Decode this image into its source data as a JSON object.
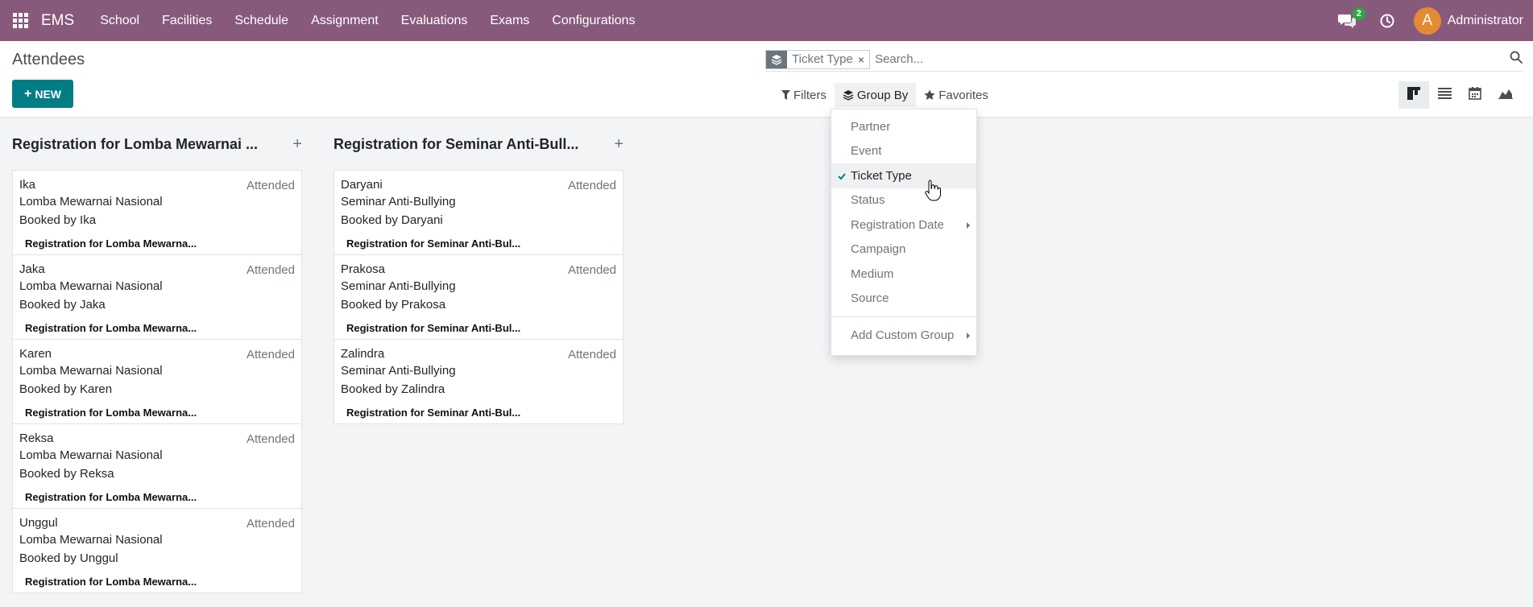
{
  "navbar": {
    "brand": "EMS",
    "menu": [
      "School",
      "Facilities",
      "Schedule",
      "Assignment",
      "Evaluations",
      "Exams",
      "Configurations"
    ],
    "chat_badge": "2",
    "avatar_letter": "A",
    "user_name": "Administrator",
    "color": "#875a7b"
  },
  "control_panel": {
    "title": "Attendees",
    "new_label": "NEW",
    "search": {
      "facet_label": "Ticket Type",
      "facet_remove": "×",
      "placeholder": "Search..."
    },
    "options": {
      "filters": "Filters",
      "group_by": "Group By",
      "favorites": "Favorites"
    },
    "views": [
      "kanban-icon",
      "list-icon",
      "calendar-icon",
      "graph-icon"
    ]
  },
  "dropdown": {
    "items": [
      {
        "label": "Partner"
      },
      {
        "label": "Event"
      },
      {
        "label": "Ticket Type",
        "selected": true
      },
      {
        "label": "Status"
      },
      {
        "label": "Registration Date",
        "submenu": true
      },
      {
        "label": "Campaign"
      },
      {
        "label": "Medium"
      },
      {
        "label": "Source"
      }
    ],
    "custom_group": "Add Custom Group"
  },
  "columns": [
    {
      "title": "Registration for Lomba Mewarnai ...",
      "cards": [
        {
          "name": "Ika",
          "status": "Attended",
          "event": "Lomba Mewarnai Nasional",
          "booked": "Booked by Ika",
          "ticket": "Registration for Lomba Mewarna..."
        },
        {
          "name": "Jaka",
          "status": "Attended",
          "event": "Lomba Mewarnai Nasional",
          "booked": "Booked by Jaka",
          "ticket": "Registration for Lomba Mewarna..."
        },
        {
          "name": "Karen",
          "status": "Attended",
          "event": "Lomba Mewarnai Nasional",
          "booked": "Booked by Karen",
          "ticket": "Registration for Lomba Mewarna..."
        },
        {
          "name": "Reksa",
          "status": "Attended",
          "event": "Lomba Mewarnai Nasional",
          "booked": "Booked by Reksa",
          "ticket": "Registration for Lomba Mewarna..."
        },
        {
          "name": "Unggul",
          "status": "Attended",
          "event": "Lomba Mewarnai Nasional",
          "booked": "Booked by Unggul",
          "ticket": "Registration for Lomba Mewarna..."
        }
      ]
    },
    {
      "title": "Registration for Seminar Anti-Bull...",
      "cards": [
        {
          "name": "Daryani",
          "status": "Attended",
          "event": "Seminar Anti-Bullying",
          "booked": "Booked by Daryani",
          "ticket": "Registration for Seminar Anti-Bul..."
        },
        {
          "name": "Prakosa",
          "status": "Attended",
          "event": "Seminar Anti-Bullying",
          "booked": "Booked by Prakosa",
          "ticket": "Registration for Seminar Anti-Bul..."
        },
        {
          "name": "Zalindra",
          "status": "Attended",
          "event": "Seminar Anti-Bullying",
          "booked": "Booked by Zalindra",
          "ticket": "Registration for Seminar Anti-Bul..."
        }
      ]
    }
  ]
}
